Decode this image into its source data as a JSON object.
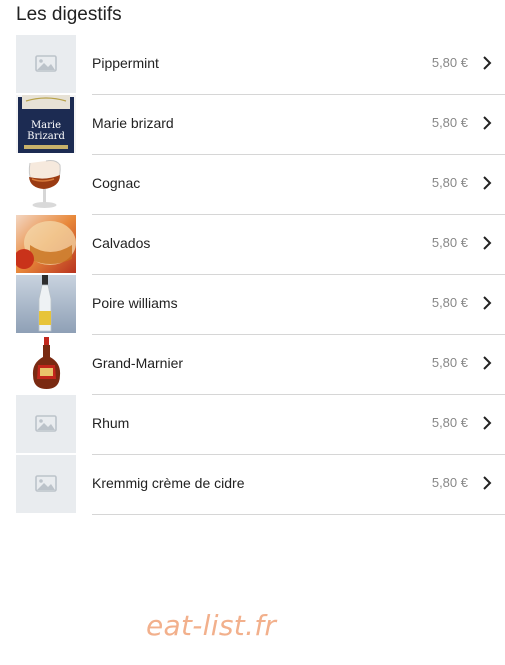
{
  "section": {
    "title": "Les digestifs"
  },
  "items": [
    {
      "name": "Pippermint",
      "price": "5,80 €",
      "image": "placeholder-image-icon"
    },
    {
      "name": "Marie brizard",
      "price": "5,80 €",
      "image": "marie-brizard-bottle",
      "label_lines": [
        "Marie",
        "Brizard"
      ]
    },
    {
      "name": "Cognac",
      "price": "5,80 €",
      "image": "cognac-glass"
    },
    {
      "name": "Calvados",
      "price": "5,80 €",
      "image": "calvados-glass"
    },
    {
      "name": "Poire williams",
      "price": "5,80 €",
      "image": "poire-williams-bottle"
    },
    {
      "name": "Grand-Marnier",
      "price": "5,80 €",
      "image": "grand-marnier-bottle"
    },
    {
      "name": "Rhum",
      "price": "5,80 €",
      "image": "placeholder-image-icon"
    },
    {
      "name": "Kremmig crème de cidre",
      "price": "5,80 €",
      "image": "placeholder-image-icon"
    }
  ],
  "watermark": "eat-list.fr"
}
